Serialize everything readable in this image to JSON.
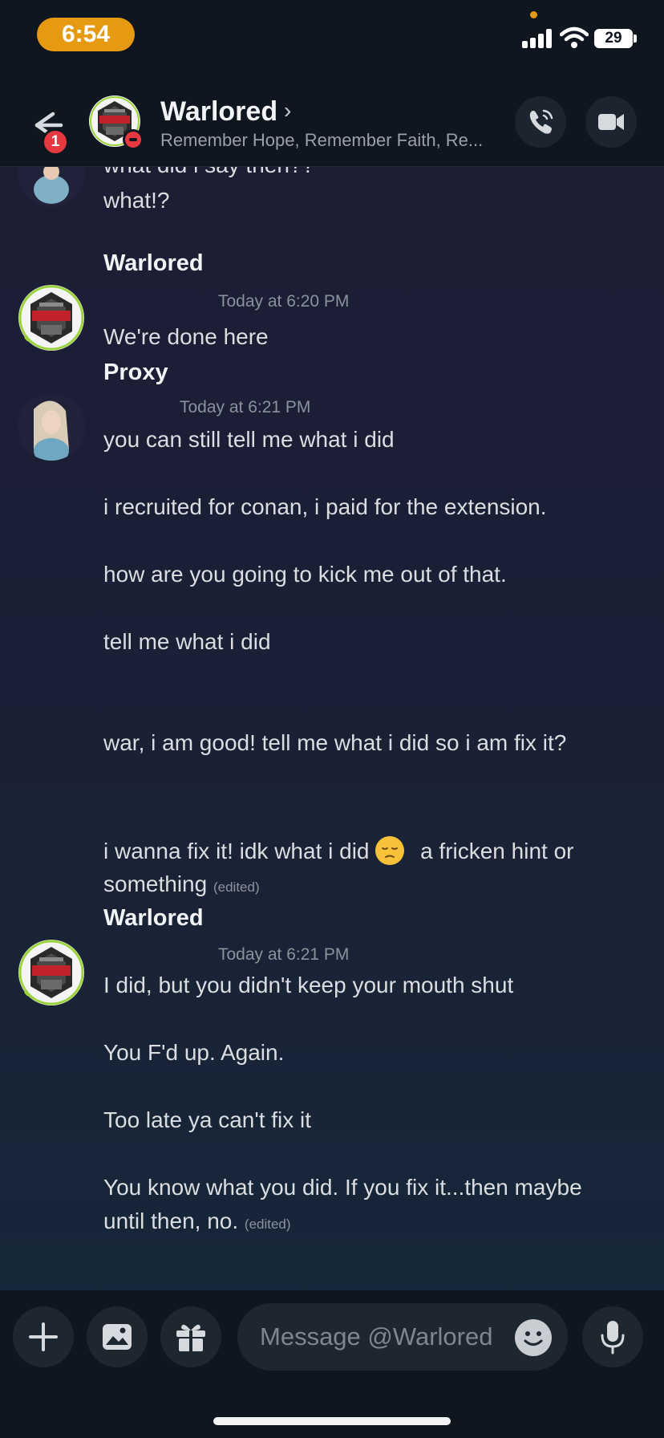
{
  "status_bar": {
    "time": "6:54",
    "battery": "29"
  },
  "header": {
    "unread_count": "1",
    "name": "Warlored",
    "chevron": "›",
    "custom_status": "Remember Hope, Remember Faith, Re..."
  },
  "messages": {
    "prev": {
      "lines": [
        "what did i say then??",
        "what!?"
      ]
    },
    "m1": {
      "author": "Warlored",
      "timestamp": "Today at 6:20 PM",
      "lines": [
        "We're done here"
      ]
    },
    "m2": {
      "author": "Proxy",
      "timestamp": "Today at 6:21 PM",
      "lines": [
        "you can still tell me what i did",
        "i recruited for conan, i paid for the extension.",
        "how are you going to kick me out of that.",
        "tell me what i did",
        "war, i am good! tell me what i did so i am fix it?",
        "i wanna fix it! idk what i did",
        "a fricken hint or",
        "something"
      ],
      "edited": "(edited)"
    },
    "m3": {
      "author": "Warlored",
      "timestamp": "Today at 6:21 PM",
      "lines": [
        "I did, but you didn't keep your mouth shut",
        "You F'd up. Again.",
        "Too late ya can't fix it",
        "You know what you did. If you fix it...then maybe",
        "until then, no."
      ],
      "edited": "(edited)"
    }
  },
  "composer": {
    "placeholder": "Message @Warlored"
  },
  "icons": [
    "back-arrow-icon",
    "phone-icon",
    "video-camera-icon",
    "plus-icon",
    "image-icon",
    "gift-icon",
    "emoji-icon",
    "microphone-icon",
    "pensive-face-emoji"
  ],
  "colors": {
    "accent_orange": "#e59a12",
    "badge_red": "#e5383f",
    "avatar_ring": "#9bd43a"
  }
}
